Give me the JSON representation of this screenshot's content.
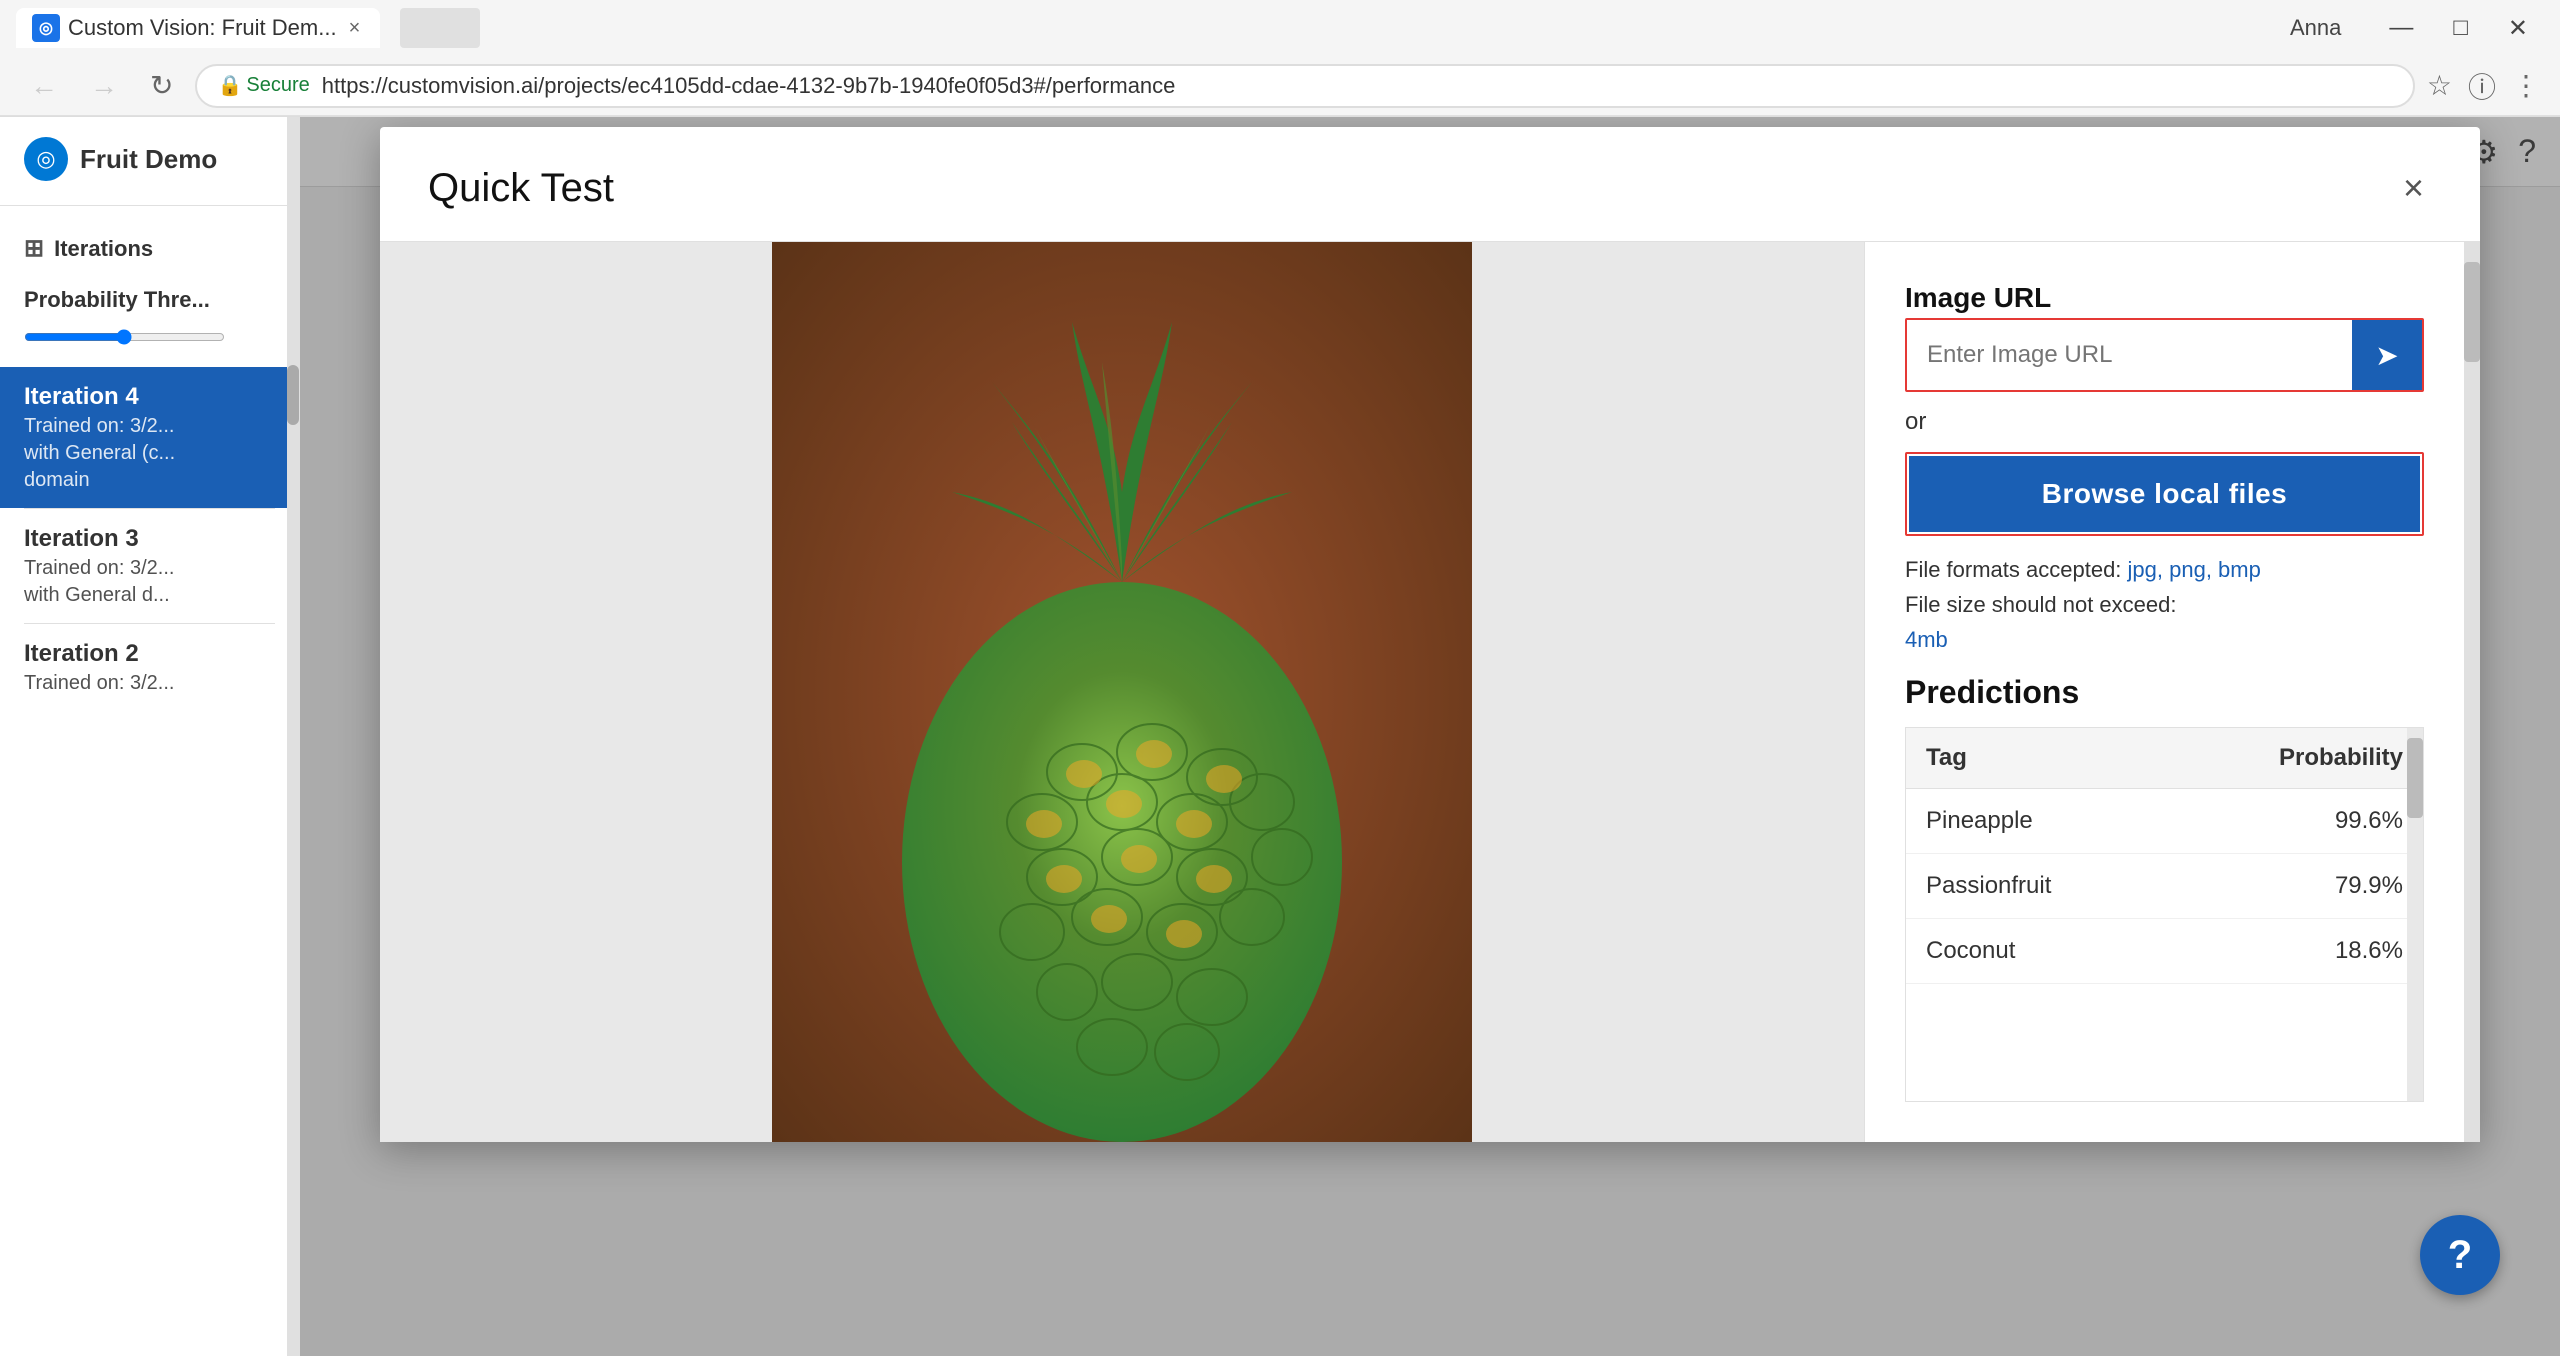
{
  "browser": {
    "tab_title": "Custom Vision: Fruit Dem...",
    "url": "https://customvision.ai/projects/ec4105dd-cdae-4132-9b7b-1940fe0f05d3#/performance",
    "secure_label": "Secure",
    "user_name": "Anna"
  },
  "app": {
    "logo_text": "Fruit Demo",
    "settings_icon": "⚙",
    "help_icon": "?"
  },
  "sidebar": {
    "iterations_label": "Iterations",
    "probability_threshold_label": "Probability Thre...",
    "iterations": [
      {
        "name": "Iteration 4",
        "detail_line1": "Trained on: 3/2...",
        "detail_line2": "with General (c...",
        "detail_line3": "domain",
        "active": true
      },
      {
        "name": "Iteration 3",
        "detail_line1": "Trained on: 3/2...",
        "detail_line2": "with General d...",
        "active": false
      },
      {
        "name": "Iteration 2",
        "detail_line1": "Trained on: 3/2...",
        "active": false
      }
    ]
  },
  "modal": {
    "title": "Quick Test",
    "close_label": "×",
    "image_url_label": "Image URL",
    "url_input_placeholder": "Enter Image URL",
    "or_text": "or",
    "browse_button_label": "Browse local files",
    "file_formats_text": "File formats accepted: ",
    "file_formats_links": "jpg, png, bmp",
    "file_size_text": "File size should not exceed:",
    "file_size_limit": "4mb",
    "predictions_title": "Predictions",
    "table_col_tag": "Tag",
    "table_col_probability": "Probability",
    "predictions": [
      {
        "tag": "Pineapple",
        "probability": "99.6%"
      },
      {
        "tag": "Passionfruit",
        "probability": "79.9%"
      },
      {
        "tag": "Coconut",
        "probability": "18.6%"
      }
    ]
  }
}
